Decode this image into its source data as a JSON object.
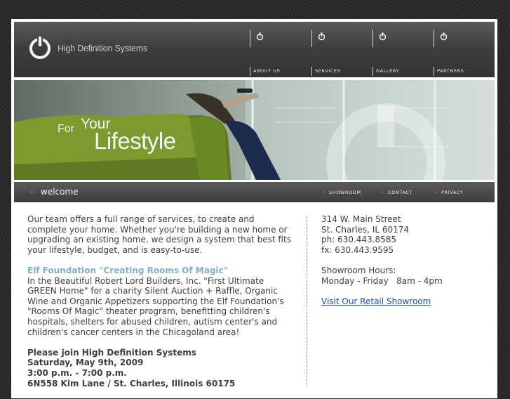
{
  "brand": {
    "name": "High Definition Systems",
    "logo_icon": "power-icon"
  },
  "nav": [
    {
      "label": "ABOUT US"
    },
    {
      "label": "SERVICES"
    },
    {
      "label": "GALLERY"
    },
    {
      "label": "PARTNERS"
    }
  ],
  "hero": {
    "tagline_for": "For",
    "tagline_your": "Your",
    "tagline_lifestyle": "Lifestyle"
  },
  "welcome_bar": {
    "title": "welcome",
    "links": [
      {
        "label": "SHOWROOM"
      },
      {
        "label": "CONTACT"
      },
      {
        "label": "PRIVACY"
      }
    ]
  },
  "main": {
    "intro": "Our team offers a full range of services, to create and complete your home. Whether you're building a new home or upgrading an existing home, we design a system that best fits your lifestyle, budget, and is easy-to-use.",
    "elf_heading": "Elf Foundation \"Creating Rooms Of Magic\"",
    "elf_body": "In the Beautiful Robert Lord Builders, Inc. \"First Ultimate GREEN Home\" for a charity Silent Auction + Raffle, Organic Wine and Organic Appetizers supporting the Elf Foundation's \"Rooms Of Magic\" theater program, benefitting children's hospitals, shelters for abused children, autism center's and children's cancer centers in the Chicagoland area!",
    "join_heading": "Please join High Definition Systems",
    "join_date": "Saturday, May 9th, 2009",
    "join_time": "3:00 p.m. - 7:00 p.m.",
    "join_address": "6N558 Kim Lane / St. Charles, Illinois 60175"
  },
  "contact": {
    "street": "314 W. Main Street",
    "city": "St. Charles, IL 60174",
    "phone": "ph: 630.443.8585",
    "fax": "fx: 630.443.9595",
    "hours_label": "Showroom Hours:",
    "hours": "Monday - Friday   8am - 4pm",
    "showroom_link": "Visit Our Retail Showroom"
  }
}
